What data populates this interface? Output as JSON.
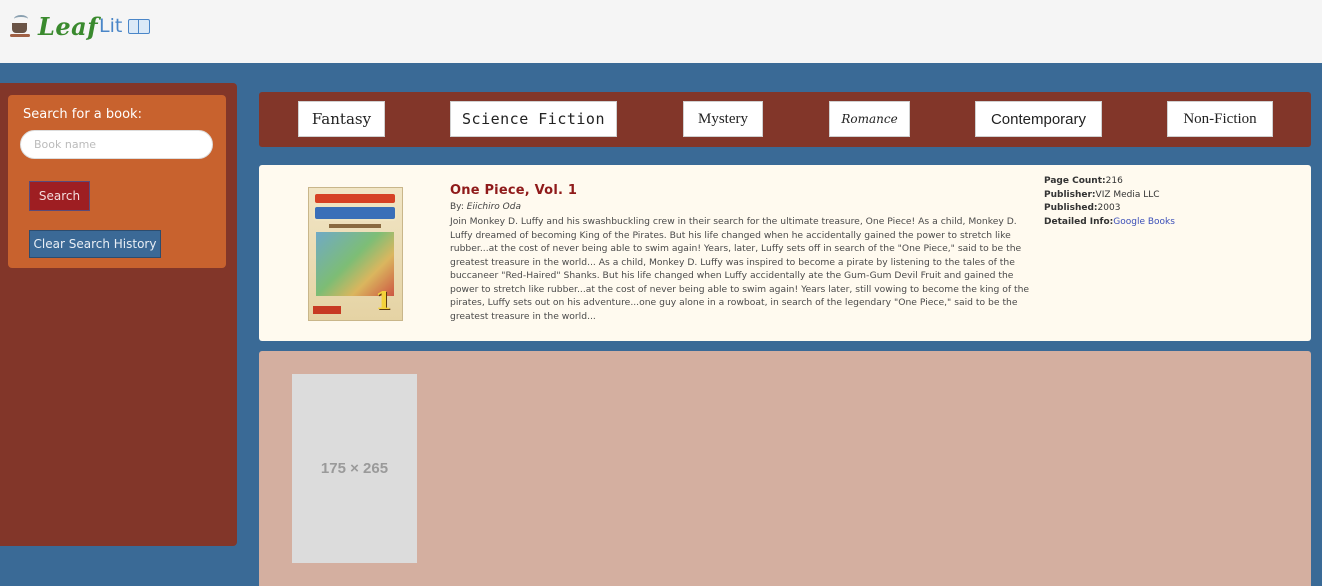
{
  "brand": {
    "part1": "Leaf",
    "part2": "Lit",
    "icons": [
      "coffee-cup-icon",
      "open-book-icon"
    ]
  },
  "search": {
    "title": "Search for a book:",
    "placeholder": "Book name",
    "value": "",
    "button_label": "Search",
    "clear_label": "Clear Search History"
  },
  "genres": [
    {
      "label": "Fantasy"
    },
    {
      "label": "Science Fiction"
    },
    {
      "label": "Mystery"
    },
    {
      "label": "Romance"
    },
    {
      "label": "Contemporary"
    },
    {
      "label": "Non-Fiction"
    }
  ],
  "book": {
    "title": "One Piece, Vol. 1",
    "author_prefix": "By:",
    "author": "Eiichiro Oda",
    "description": "Join Monkey D. Luffy and his swashbuckling crew in their search for the ultimate treasure, One Piece! As a child, Monkey D. Luffy dreamed of becoming King of the Pirates. But his life changed when he accidentally gained the power to stretch like rubber...at the cost of never being able to swim again! Years, later, Luffy sets off in search of the \"One Piece,\" said to be the greatest treasure in the world... As a child, Monkey D. Luffy was inspired to become a pirate by listening to the tales of the buccaneer \"Red-Haired\" Shanks. But his life changed when Luffy accidentally ate the Gum-Gum Devil Fruit and gained the power to stretch like rubber...at the cost of never being able to swim again! Years later, still vowing to become the king of the pirates, Luffy sets out on his adventure...one guy alone in a rowboat, in search of the legendary \"One Piece,\" said to be the greatest treasure in the world...",
    "page_count_label": "Page Count:",
    "page_count": "216",
    "publisher_label": "Publisher:",
    "publisher": "VIZ Media LLC",
    "published_label": "Published:",
    "published": "2003",
    "detailed_label": "Detailed Info:",
    "detailed_link": "Google Books"
  },
  "placeholder_image": {
    "text": "175 × 265"
  },
  "colors": {
    "page_bg": "#3a6a96",
    "sidebar": "#823629",
    "search_panel": "#c8622e",
    "search_button": "#9e1e22",
    "clear_button": "#3b6996",
    "card_bg": "#fffaef",
    "results_bg": "#d4afa0",
    "title": "#8f1a1a",
    "link": "#3b4fb8"
  }
}
